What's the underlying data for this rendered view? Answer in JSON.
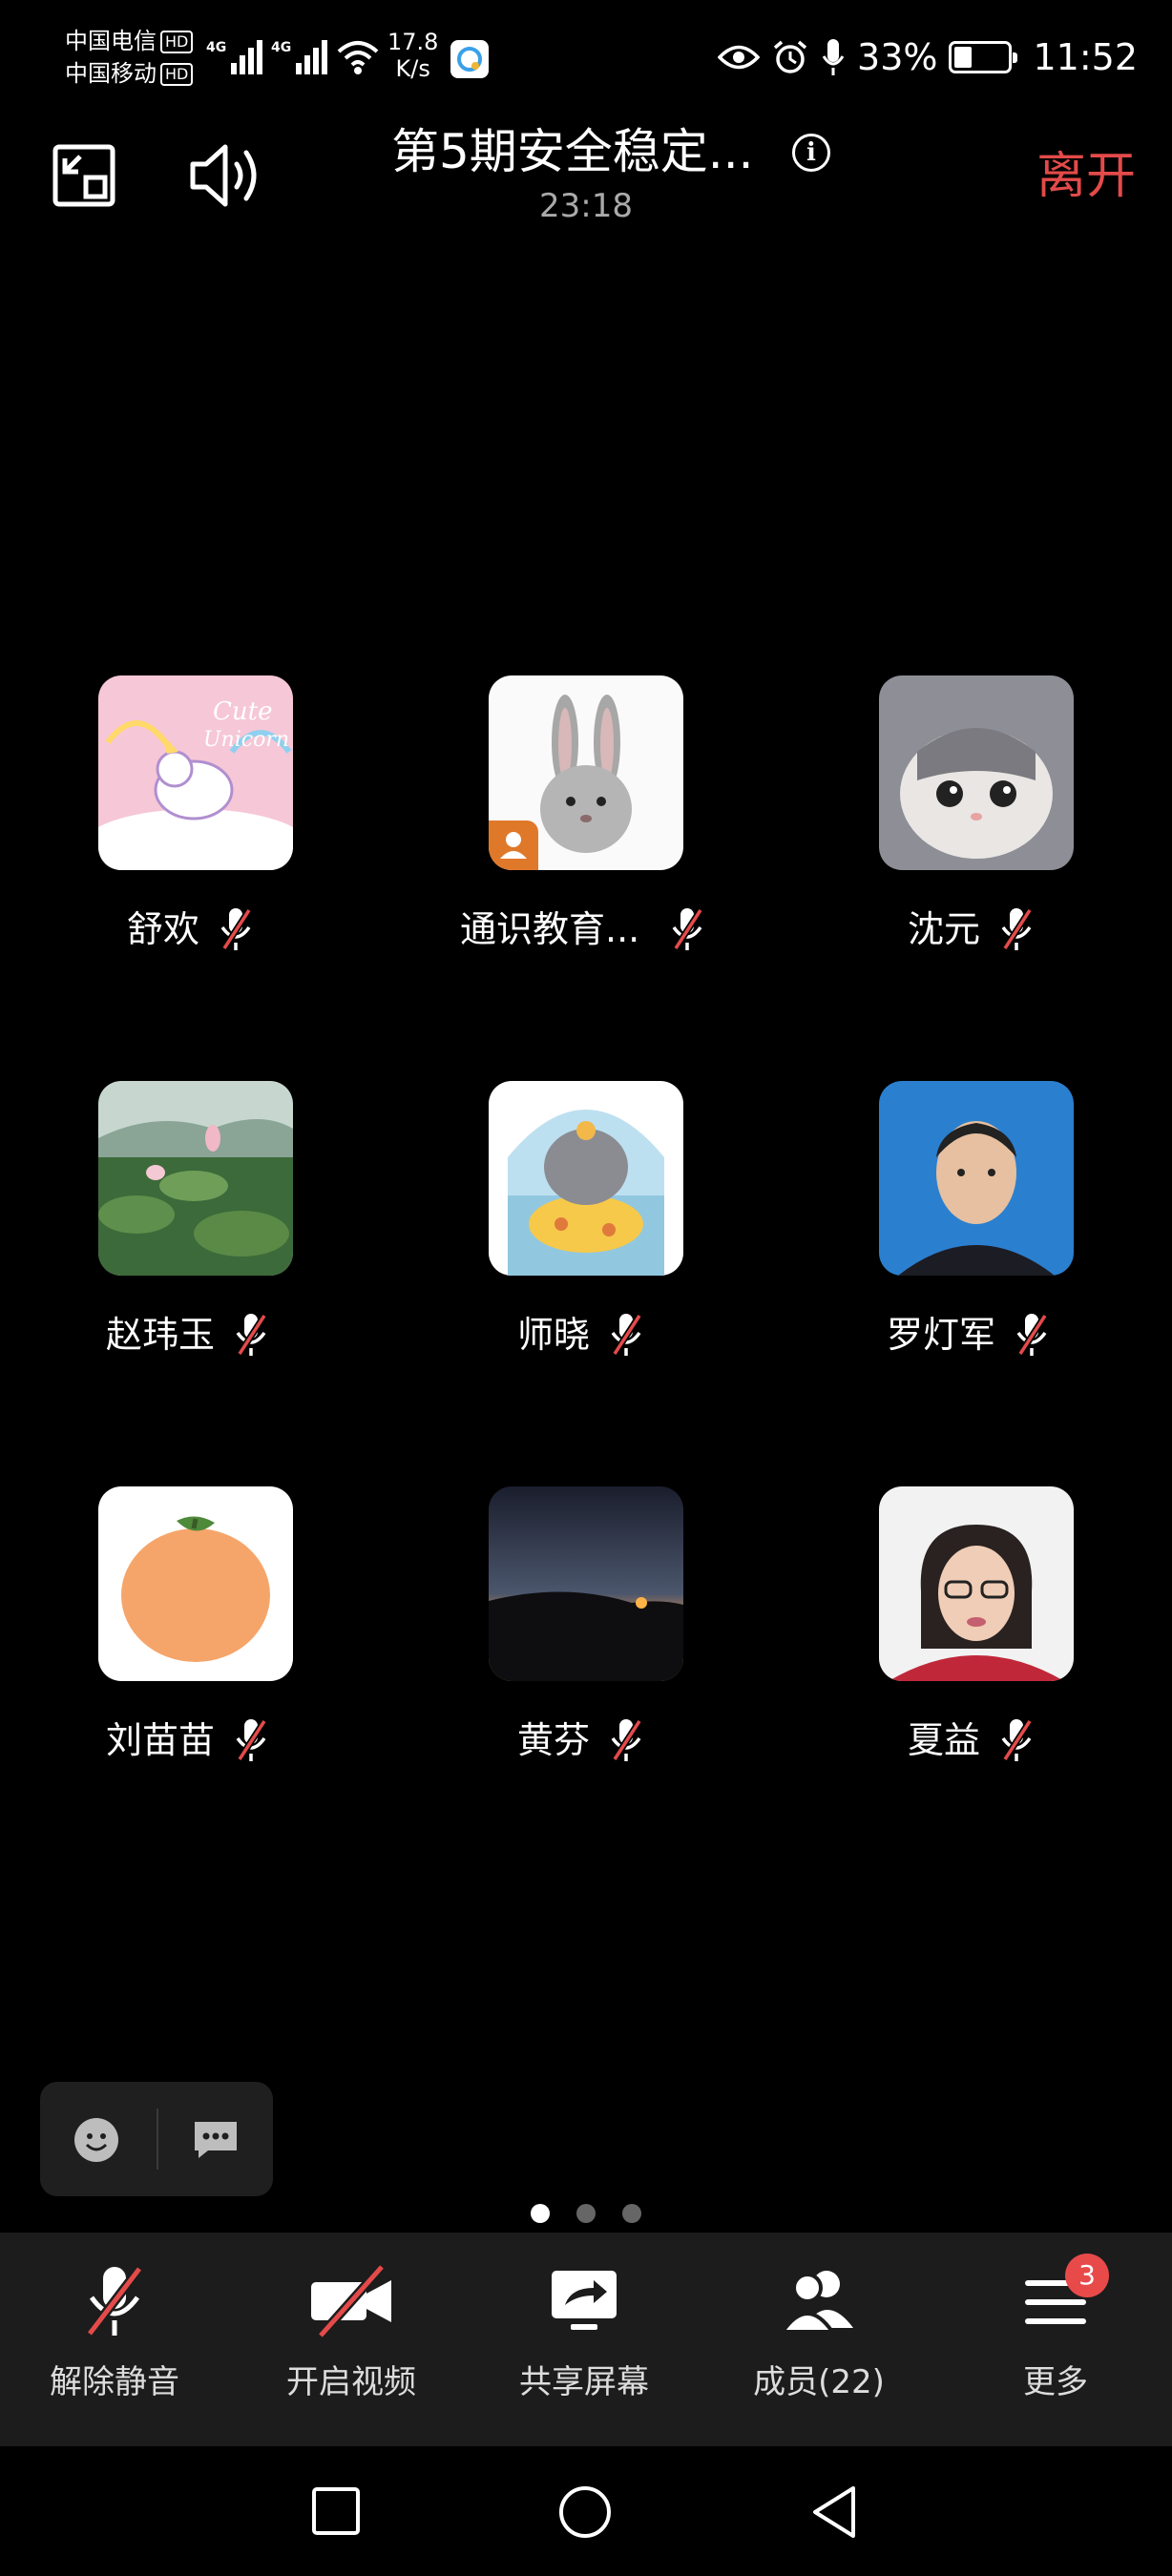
{
  "status_bar": {
    "carrier1": "中国电信",
    "carrier2": "中国移动",
    "hd": "HD",
    "net_type": "4G",
    "net_speed_value": "17.8",
    "net_speed_unit": "K/s",
    "battery_percent": "33%",
    "battery_level": 0.33,
    "time": "11:52"
  },
  "header": {
    "title": "第5期安全稳定...",
    "duration": "23:18",
    "leave_label": "离开"
  },
  "participants": [
    {
      "name": "舒欢",
      "avatar": "unicorn-avatar"
    },
    {
      "name": "通识教育...",
      "avatar": "rabbit-avatar",
      "host": true
    },
    {
      "name": "沈元",
      "avatar": "cat-avatar"
    },
    {
      "name": "赵玮玉",
      "avatar": "lotus-avatar"
    },
    {
      "name": "师晓",
      "avatar": "elephant-avatar"
    },
    {
      "name": "罗灯军",
      "avatar": "man-photo-avatar"
    },
    {
      "name": "刘苗苗",
      "avatar": "orange-avatar"
    },
    {
      "name": "黄芬",
      "avatar": "sunset-avatar"
    },
    {
      "name": "夏益",
      "avatar": "woman-photo-avatar"
    }
  ],
  "pager": {
    "pages": 3,
    "current": 1
  },
  "toolbar": {
    "unmute": "解除静音",
    "video": "开启视频",
    "share": "共享屏幕",
    "members": "成员(22)",
    "more": "更多",
    "more_badge": "3"
  },
  "colors": {
    "leave": "#e44a4a",
    "badge": "#e84a4a",
    "toolbar_bg": "#1c1c1c"
  }
}
